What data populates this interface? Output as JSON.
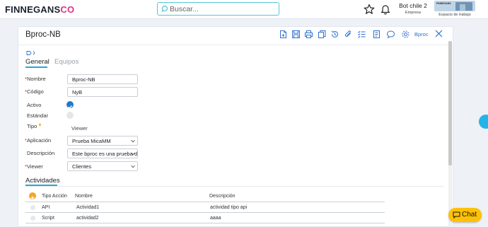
{
  "header": {
    "logo_text": "FINNEGANS",
    "logo_co": "CO",
    "search_placeholder": "Buscar...",
    "user_name": "Bot chile 2",
    "user_role": "Empresa",
    "workspace_thumb_text": "FINNEGANS",
    "workspace_label": "Espacio de trabajo",
    "icons": [
      "search-icon",
      "star-icon",
      "bell-icon"
    ]
  },
  "form": {
    "title": "Bproc-NB",
    "toolbar_icons": [
      "new-icon",
      "save-icon",
      "print-icon",
      "copy-icon",
      "history-icon",
      "attach-icon",
      "checklist-icon",
      "report-icon",
      "comment-icon",
      "settings-icon"
    ],
    "toolbar_text": "Bproc",
    "tabs": [
      {
        "label": "General",
        "active": true
      },
      {
        "label": "Equipos",
        "active": false
      }
    ],
    "fields": {
      "nombre": {
        "label": "Nombre",
        "required": true,
        "value": "Bproc-NB"
      },
      "codigo": {
        "label": "Código",
        "required": true,
        "value": "NyB"
      },
      "activo": {
        "label": "Activo",
        "checked": true
      },
      "estandar": {
        "label": "Estándar",
        "checked": false
      },
      "tipo": {
        "label": "Tipo",
        "value": "Viewer"
      },
      "aplicacion": {
        "label": "Aplicación",
        "required": true,
        "value": "Prueba  MicaMM"
      },
      "descripcion": {
        "label": "Descripción",
        "value": "Este bproc es una prueba d"
      },
      "viewer": {
        "label": "Viewer",
        "required": true,
        "value": "Clientes"
      }
    },
    "actividades": {
      "title": "Actividades",
      "columns": [
        "Tipo Acción",
        "Nombre",
        "Descripción"
      ],
      "rows": [
        {
          "tipo": "API",
          "nombre": "Actividad1",
          "descripcion": "actividad tipo api"
        },
        {
          "tipo": "Script",
          "nombre": "actividad2",
          "descripcion": "aaaa"
        }
      ]
    }
  },
  "chat": {
    "label": "Chat"
  },
  "colors": {
    "accent": "#2aa6d6",
    "brand_pink": "#e0318a",
    "chat": "#ffc107",
    "required": "#d0243a",
    "link": "#2f6fcf"
  }
}
